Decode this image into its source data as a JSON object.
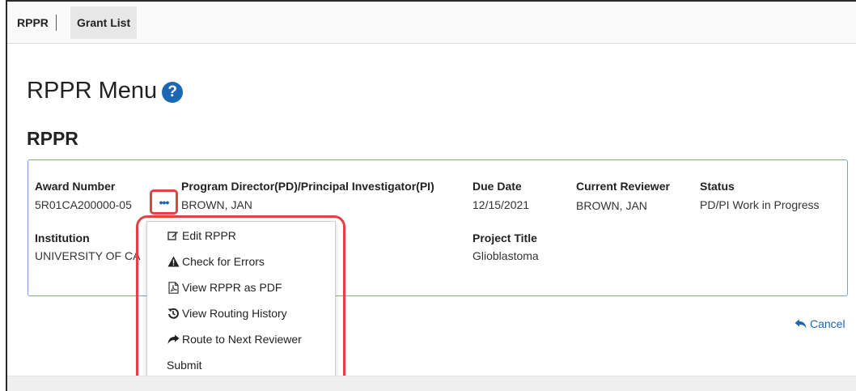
{
  "nav": {
    "rppr": "RPPR",
    "grant_list": "Grant List"
  },
  "page": {
    "title": "RPPR Menu",
    "help_icon": "?",
    "section_title": "RPPR"
  },
  "record": {
    "award_number_label": "Award Number",
    "award_number": "5R01CA200000-05",
    "pd_pi_label": "Program Director(PD)/Principal Investigator(PI)",
    "pd_pi": "BROWN, JAN",
    "due_date_label": "Due Date",
    "due_date": "12/15/2021",
    "current_reviewer_label": "Current Reviewer",
    "current_reviewer": "BROWN, JAN",
    "status_label": "Status",
    "status": "PD/PI Work in Progress",
    "institution_label": "Institution",
    "institution": "UNIVERSITY OF CA",
    "project_title_label": "Project Title",
    "project_title": "Glioblastoma"
  },
  "actions_button": "•••",
  "menu": {
    "items": [
      {
        "label": "Edit RPPR",
        "icon": "edit-icon"
      },
      {
        "label": "Check for Errors",
        "icon": "warning-icon"
      },
      {
        "label": "View RPPR as PDF",
        "icon": "pdf-icon"
      },
      {
        "label": "View Routing History",
        "icon": "history-icon"
      },
      {
        "label": "Route to Next Reviewer",
        "icon": "share-icon"
      },
      {
        "label": "Submit",
        "icon": ""
      }
    ]
  },
  "cancel_label": "Cancel",
  "colors": {
    "accent": "#1a67b3",
    "highlight": "#e04343",
    "card_border": "#7aa2d6"
  }
}
